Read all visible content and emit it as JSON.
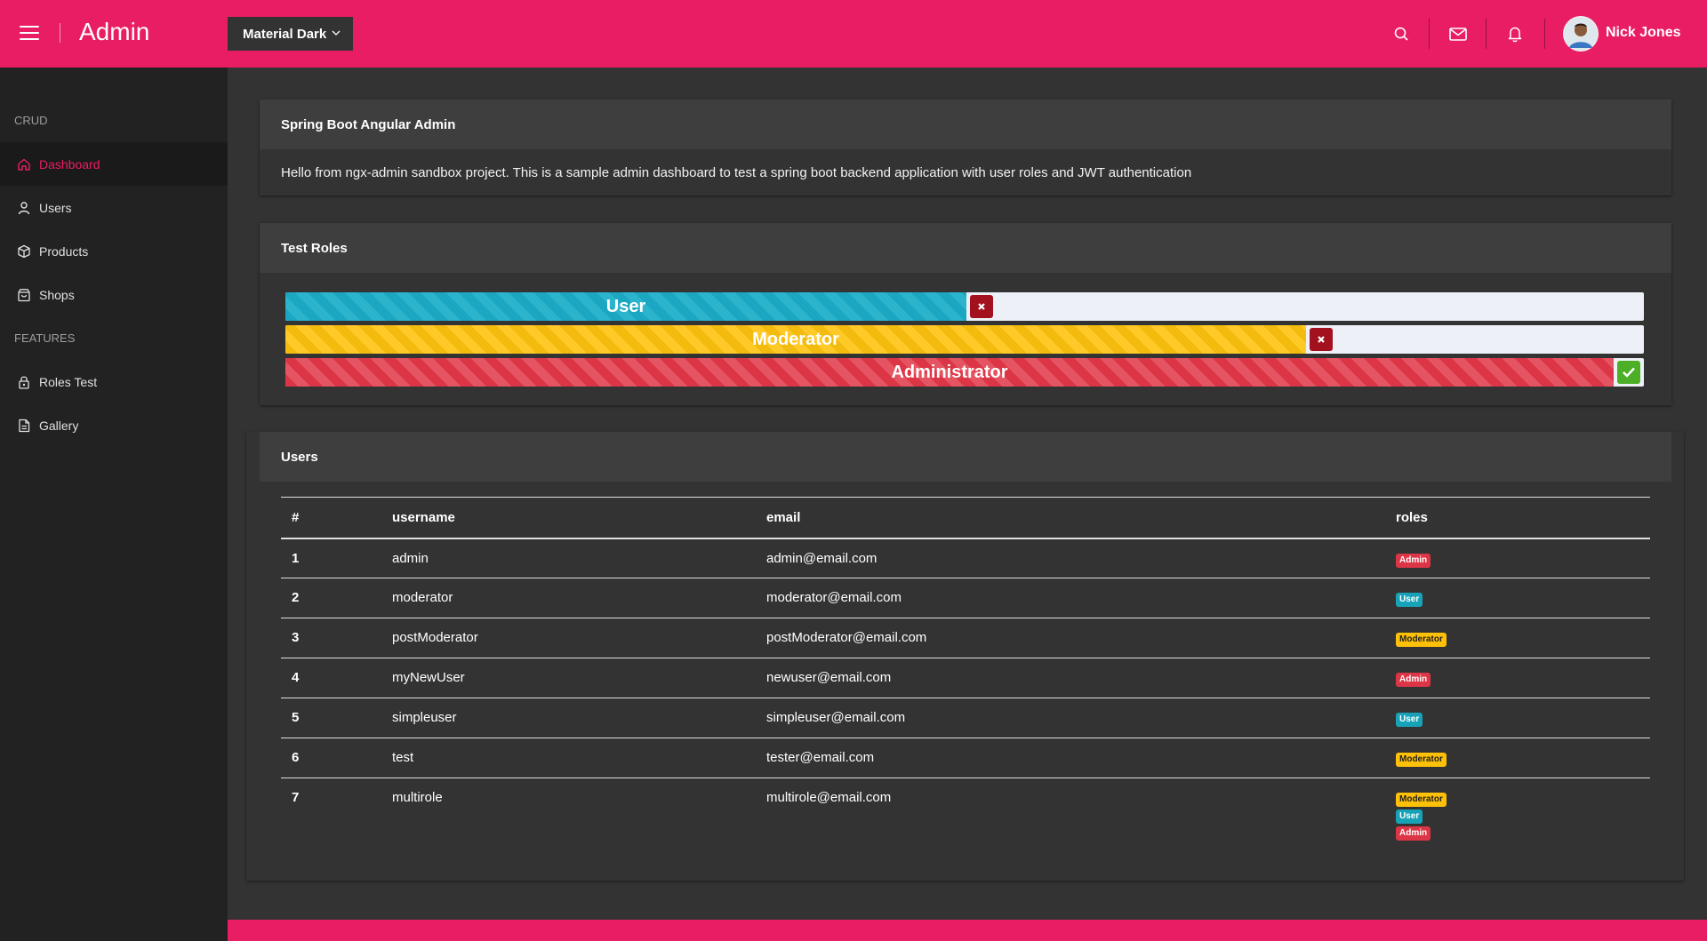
{
  "colors": {
    "accent": "#e91d63",
    "sidebar_bg": "#222222",
    "main_bg": "#333333",
    "card_head_bg": "#3e3e3e"
  },
  "header": {
    "title": "Admin",
    "theme_select": "Material Dark",
    "user_name": "Nick Jones",
    "icons": [
      "menu-icon",
      "search-icon",
      "mail-icon",
      "bell-icon"
    ]
  },
  "sidebar": {
    "sections": [
      {
        "label": "CRUD"
      },
      {
        "label": "FEATURES"
      }
    ],
    "items": [
      {
        "label": "Dashboard",
        "icon": "home-icon",
        "active": true
      },
      {
        "label": "Users",
        "icon": "person-icon"
      },
      {
        "label": "Products",
        "icon": "cube-icon"
      },
      {
        "label": "Shops",
        "icon": "shopping-bag-icon"
      },
      {
        "label": "Roles Test",
        "icon": "lock-icon"
      },
      {
        "label": "Gallery",
        "icon": "file-icon"
      }
    ]
  },
  "intro_card": {
    "title": "Spring Boot Angular Admin",
    "text": "Hello from ngx-admin sandbox project. This is a sample admin dashboard to test a spring boot backend application with user roles and JWT authentication"
  },
  "roles_card": {
    "title": "Test Roles",
    "bars": [
      {
        "label": "User",
        "fill_fraction": 0.5,
        "color": "#1ba7c1",
        "granted": false
      },
      {
        "label": "Moderator",
        "fill_fraction": 0.75,
        "color": "#ffc107",
        "granted": false
      },
      {
        "label": "Administrator",
        "fill_fraction": 1.0,
        "color": "#dc3545",
        "granted": true
      }
    ]
  },
  "users_card": {
    "title": "Users",
    "columns": [
      "#",
      "username",
      "email",
      "roles"
    ],
    "rows": [
      {
        "num": "1",
        "username": "admin",
        "email": "admin@email.com",
        "roles": [
          "Admin"
        ]
      },
      {
        "num": "2",
        "username": "moderator",
        "email": "moderator@email.com",
        "roles": [
          "User"
        ]
      },
      {
        "num": "3",
        "username": "postModerator",
        "email": "postModerator@email.com",
        "roles": [
          "Moderator"
        ]
      },
      {
        "num": "4",
        "username": "myNewUser",
        "email": "newuser@email.com",
        "roles": [
          "Admin"
        ]
      },
      {
        "num": "5",
        "username": "simpleuser",
        "email": "simpleuser@email.com",
        "roles": [
          "User"
        ]
      },
      {
        "num": "6",
        "username": "test",
        "email": "tester@email.com",
        "roles": [
          "Moderator"
        ]
      },
      {
        "num": "7",
        "username": "multirole",
        "email": "multirole@email.com",
        "roles": [
          "Moderator",
          "User",
          "Admin"
        ]
      }
    ]
  }
}
